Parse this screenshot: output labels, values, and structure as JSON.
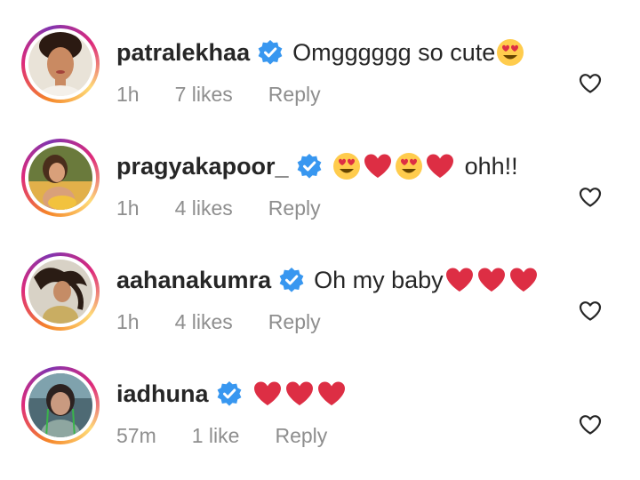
{
  "colors": {
    "username": "#262626",
    "meta": "#8e8e8e",
    "verified": "#3897f0",
    "heart_emoji": "#dd2e44"
  },
  "comments": [
    {
      "username": "patralekhaa",
      "verified": true,
      "text": "Omgggggg so cute",
      "emojis_after": [
        "smiling-heart-eyes-emoji"
      ],
      "time": "1h",
      "likes": "7 likes",
      "reply_label": "Reply"
    },
    {
      "username": "pragyakapoor_",
      "verified": true,
      "text": "ohh!!",
      "emojis_before": [
        "smiling-heart-eyes-emoji",
        "red-heart-emoji",
        "smiling-heart-eyes-emoji",
        "red-heart-emoji"
      ],
      "time": "1h",
      "likes": "4 likes",
      "reply_label": "Reply"
    },
    {
      "username": "aahanakumra",
      "verified": true,
      "text": "Oh my baby",
      "emojis_after": [
        "red-heart-emoji",
        "red-heart-emoji",
        "red-heart-emoji"
      ],
      "time": "1h",
      "likes": "4 likes",
      "reply_label": "Reply"
    },
    {
      "username": "iadhuna",
      "verified": true,
      "text": "",
      "emojis_after": [
        "red-heart-emoji",
        "red-heart-emoji",
        "red-heart-emoji"
      ],
      "time": "57m",
      "likes": "1 like",
      "reply_label": "Reply"
    }
  ]
}
